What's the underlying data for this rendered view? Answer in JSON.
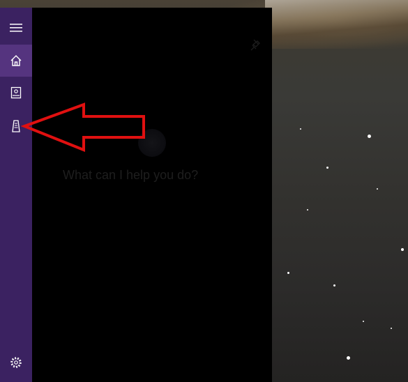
{
  "rail": {
    "items": [
      {
        "name": "menu",
        "icon": "hamburger-menu-icon"
      },
      {
        "name": "home",
        "icon": "home-icon",
        "active": true
      },
      {
        "name": "notebook",
        "icon": "notebook-icon"
      },
      {
        "name": "devices",
        "icon": "device-icon"
      }
    ],
    "settings_icon": "gear-icon"
  },
  "panel": {
    "prompt": "What can I help you do?"
  },
  "colors": {
    "rail_bg": "#3b2261",
    "rail_active": "#55347f",
    "panel_bg": "#000000",
    "arrow_stroke": "#e01010"
  }
}
